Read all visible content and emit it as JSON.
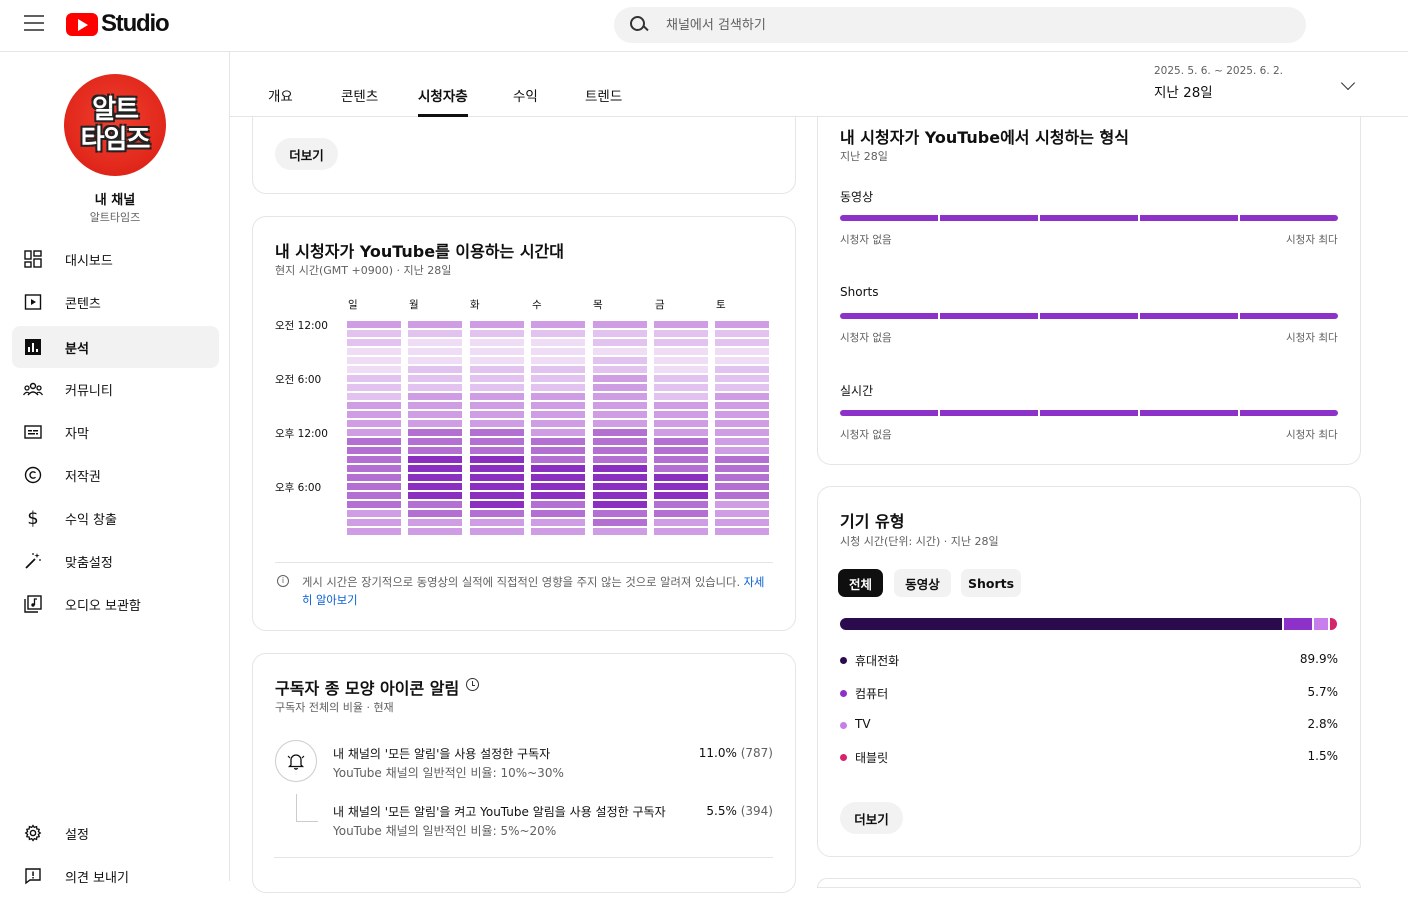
{
  "header": {
    "logo_text": "Studio",
    "search_placeholder": "채널에서 검색하기"
  },
  "channel": {
    "avatar_line1": "알트",
    "avatar_line2": "타임즈",
    "title": "내 채널",
    "name": "알트타임즈"
  },
  "sidebar": {
    "items": [
      {
        "label": "대시보드",
        "icon": "dashboard-icon"
      },
      {
        "label": "콘텐츠",
        "icon": "content-icon"
      },
      {
        "label": "분석",
        "icon": "analytics-icon"
      },
      {
        "label": "커뮤니티",
        "icon": "community-icon"
      },
      {
        "label": "자막",
        "icon": "subtitles-icon"
      },
      {
        "label": "저작권",
        "icon": "copyright-icon"
      },
      {
        "label": "수익 창출",
        "icon": "dollar-icon"
      },
      {
        "label": "맞춤설정",
        "icon": "customize-icon"
      },
      {
        "label": "오디오 보관함",
        "icon": "audio-library-icon"
      }
    ],
    "settings": "설정",
    "feedback": "의견 보내기"
  },
  "tabs": [
    "개요",
    "콘텐츠",
    "시청자층",
    "수익",
    "트렌드"
  ],
  "active_tab": "시청자층",
  "date": {
    "range": "2025. 5. 6. ~ 2025. 6. 2.",
    "period": "지난 28일"
  },
  "top_card": {
    "more_button": "더보기"
  },
  "when_card": {
    "title": "내 시청자가 YouTube를 이용하는 시간대",
    "subtitle": "현지 시간(GMT +0900) · 지난 28일",
    "days": [
      "일",
      "월",
      "화",
      "수",
      "목",
      "금",
      "토"
    ],
    "times": [
      "오전 12:00",
      "오전 6:00",
      "오후 12:00",
      "오후 6:00"
    ],
    "note": "게시 시간은 장기적으로 동영상의 실적에 직접적인 영향을 주지 않는 것으로 알려져 있습니다.",
    "note_link": "자세히 알아보기"
  },
  "chart_data": {
    "type": "heatmap",
    "title": "내 시청자가 YouTube를 이용하는 시간대",
    "x": [
      "일",
      "월",
      "화",
      "수",
      "목",
      "금",
      "토"
    ],
    "y_ticks": [
      "오전 12:00",
      "오전 6:00",
      "오후 12:00",
      "오후 6:00"
    ],
    "rows": 24,
    "values": [
      [
        3,
        2,
        2,
        1,
        1,
        1,
        2,
        2,
        2,
        3,
        3,
        3,
        3,
        4,
        4,
        4,
        4,
        4,
        4,
        4,
        4,
        3,
        3,
        3
      ],
      [
        3,
        2,
        1,
        1,
        1,
        2,
        2,
        2,
        3,
        3,
        3,
        3,
        4,
        4,
        4,
        5,
        5,
        5,
        5,
        5,
        4,
        4,
        3,
        3
      ],
      [
        3,
        2,
        1,
        1,
        1,
        2,
        2,
        2,
        3,
        3,
        3,
        3,
        4,
        4,
        4,
        5,
        5,
        5,
        5,
        5,
        5,
        4,
        3,
        3
      ],
      [
        3,
        2,
        1,
        1,
        1,
        2,
        2,
        2,
        3,
        3,
        3,
        3,
        3,
        4,
        4,
        4,
        5,
        5,
        5,
        5,
        4,
        4,
        3,
        3
      ],
      [
        3,
        2,
        2,
        1,
        2,
        2,
        3,
        3,
        3,
        3,
        3,
        3,
        4,
        4,
        4,
        4,
        5,
        5,
        5,
        5,
        5,
        4,
        4,
        3
      ],
      [
        3,
        2,
        2,
        1,
        1,
        1,
        2,
        2,
        2,
        3,
        3,
        3,
        3,
        4,
        4,
        4,
        4,
        5,
        5,
        5,
        4,
        4,
        3,
        3
      ],
      [
        3,
        2,
        2,
        1,
        1,
        2,
        2,
        2,
        3,
        3,
        3,
        3,
        3,
        3,
        3,
        4,
        4,
        4,
        4,
        4,
        3,
        3,
        3,
        3
      ]
    ]
  },
  "format_card": {
    "title": "내 시청자가 YouTube에서 시청하는 형식",
    "subtitle": "지난 28일",
    "rows": [
      {
        "label": "동영상",
        "min": "시청자 없음",
        "max": "시청자 최다"
      },
      {
        "label": "Shorts",
        "min": "시청자 없음",
        "max": "시청자 최다"
      },
      {
        "label": "실시간",
        "min": "시청자 없음",
        "max": "시청자 최다"
      }
    ]
  },
  "device_card": {
    "title": "기기 유형",
    "subtitle": "시청 시간(단위: 시간) · 지난 28일",
    "chips": [
      "전체",
      "동영상",
      "Shorts"
    ],
    "active_chip": "전체",
    "items": [
      {
        "name": "휴대전화",
        "value": "89.9%",
        "pct": 89.9,
        "color": "#2b0a4d"
      },
      {
        "name": "컴퓨터",
        "value": "5.7%",
        "pct": 5.7,
        "color": "#8d32c8"
      },
      {
        "name": "TV",
        "value": "2.8%",
        "pct": 2.8,
        "color": "#c77dea"
      },
      {
        "name": "태블릿",
        "value": "1.5%",
        "pct": 1.5,
        "color": "#d6246c"
      }
    ],
    "more_button": "더보기"
  },
  "bell_card": {
    "title": "구독자 종 모양 아이콘 알림",
    "subtitle": "구독자 전체의 비율 · 현재",
    "rows": [
      {
        "main": "내 채널의 '모든 알림'을 사용 설정한 구독자",
        "sub": "YouTube 채널의 일반적인 비율: 10%~30%",
        "value": "11.0%",
        "count": "(787)"
      },
      {
        "main": "내 채널의 '모든 알림'을 켜고 YouTube 알림을 사용 설정한 구독자",
        "sub": "YouTube 채널의 일반적인 비율: 5%~20%",
        "value": "5.5%",
        "count": "(394)"
      }
    ]
  },
  "colors": {
    "accent": "#8d32c8",
    "heat_levels": [
      "#f7effb",
      "#efddf6",
      "#e2c2ef",
      "#cf9de3",
      "#b46fd3",
      "#8a2fc0"
    ]
  }
}
